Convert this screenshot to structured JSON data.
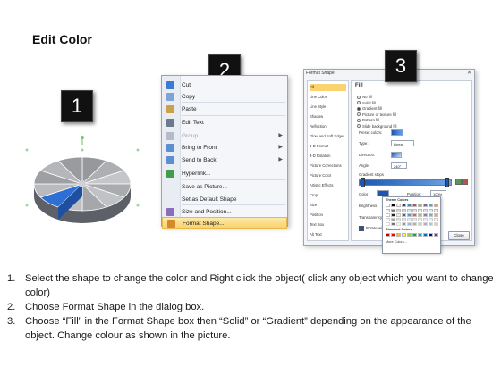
{
  "title": "Edit Color",
  "badges": [
    "1",
    "2",
    "3"
  ],
  "context_menu": {
    "items": [
      {
        "label": "Cut",
        "icon": "scissors-icon",
        "disabled": false,
        "submenu": false,
        "highlight": false,
        "color": "#3a7bd5"
      },
      {
        "label": "Copy",
        "icon": "copy-icon",
        "disabled": false,
        "submenu": false,
        "highlight": false,
        "color": "#7ea3d8"
      },
      {
        "label": "Paste",
        "icon": "paste-icon",
        "disabled": false,
        "submenu": false,
        "highlight": false,
        "color": "#c9a24a"
      },
      {
        "label": "Edit Text",
        "icon": "edit-text-icon",
        "disabled": false,
        "submenu": false,
        "highlight": false,
        "color": "#6d7a8c"
      },
      {
        "label": "Group",
        "icon": "group-icon",
        "disabled": true,
        "submenu": true,
        "highlight": false,
        "color": "#b5bcc7"
      },
      {
        "label": "Bring to Front",
        "icon": "bring-to-front-icon",
        "disabled": false,
        "submenu": true,
        "highlight": false,
        "color": "#5b8fd0"
      },
      {
        "label": "Send to Back",
        "icon": "send-to-back-icon",
        "disabled": false,
        "submenu": true,
        "highlight": false,
        "color": "#5b8fd0"
      },
      {
        "label": "Hyperlink...",
        "icon": "hyperlink-icon",
        "disabled": false,
        "submenu": false,
        "highlight": false,
        "color": "#3f9e4d"
      },
      {
        "label": "Save as Picture...",
        "icon": "",
        "disabled": false,
        "submenu": false,
        "highlight": false,
        "color": ""
      },
      {
        "label": "Set as Default Shape",
        "icon": "",
        "disabled": false,
        "submenu": false,
        "highlight": false,
        "color": ""
      },
      {
        "label": "Size and Position...",
        "icon": "size-position-icon",
        "disabled": false,
        "submenu": false,
        "highlight": false,
        "color": "#8a6fb8"
      },
      {
        "label": "Format Shape...",
        "icon": "format-shape-icon",
        "disabled": false,
        "submenu": false,
        "highlight": true,
        "color": "#d48a2c"
      }
    ]
  },
  "dialog": {
    "title": "Format Shape",
    "categories": [
      "Fill",
      "Line Color",
      "Line Style",
      "Shadow",
      "Reflection",
      "Glow and Soft Edges",
      "3-D Format",
      "3-D Rotation",
      "Picture Corrections",
      "Picture Color",
      "Artistic Effects",
      "Crop",
      "Size",
      "Position",
      "Text Box",
      "Alt Text"
    ],
    "selected_category": "Fill",
    "pane_title": "Fill",
    "fill_options": [
      "No fill",
      "Solid fill",
      "Gradient fill",
      "Picture or texture fill",
      "Pattern fill",
      "Slide background fill"
    ],
    "selected_fill": "Gradient fill",
    "preset_colors_label": "Preset colors:",
    "type_label": "Type:",
    "type_value": "Linear",
    "direction_label": "Direction:",
    "angle_label": "Angle:",
    "angle_value": "240°",
    "gradient_stops_label": "Gradient stops",
    "color_label": "Color",
    "position_label": "Position:",
    "position_value": "100%",
    "brightness_label": "Brightness",
    "transparency_label": "Transparency",
    "rotate_label": "Rotate with shape",
    "theme_colors_label": "Theme Colors",
    "standard_colors_label": "Standard Colors",
    "more_colors_label": "More Colors...",
    "close_label": "Close",
    "theme_top_row": [
      "#ffffff",
      "#000000",
      "#eeece1",
      "#1f497d",
      "#4f81bd",
      "#c0504d",
      "#9bbb59",
      "#8064a2",
      "#4bacc6",
      "#f79646"
    ],
    "theme_shades": [
      "#f2f2f2",
      "#7f7f7f",
      "#ddd9c3",
      "#c6d9f0",
      "#dbe5f1",
      "#f2dcdb",
      "#ebf1dd",
      "#e5e0ec",
      "#dbeef3",
      "#fdeada"
    ],
    "standard_colors": [
      "#c00000",
      "#ff0000",
      "#ffc000",
      "#ffff00",
      "#92d050",
      "#00b050",
      "#00b0f0",
      "#0070c0",
      "#002060",
      "#7030a0"
    ],
    "stop_colors": [
      "#1c56b0",
      "#3d7fd6",
      "#6aa3e6"
    ]
  },
  "pie": {
    "base_color": "#8e9196",
    "highlight_color": "#2e6fd6"
  },
  "instructions": [
    {
      "num": "1.",
      "text": "Select the shape to change the color and Right click the object( click any object which you want to change color)"
    },
    {
      "num": "2.",
      "text": "Choose Format Shape in the dialog box."
    },
    {
      "num": "3.",
      "text": "Choose “Fill” in the Format Shape box then “Solid” or “Gradient” depending on the appearance of the object. Change colour as shown in the picture."
    }
  ]
}
